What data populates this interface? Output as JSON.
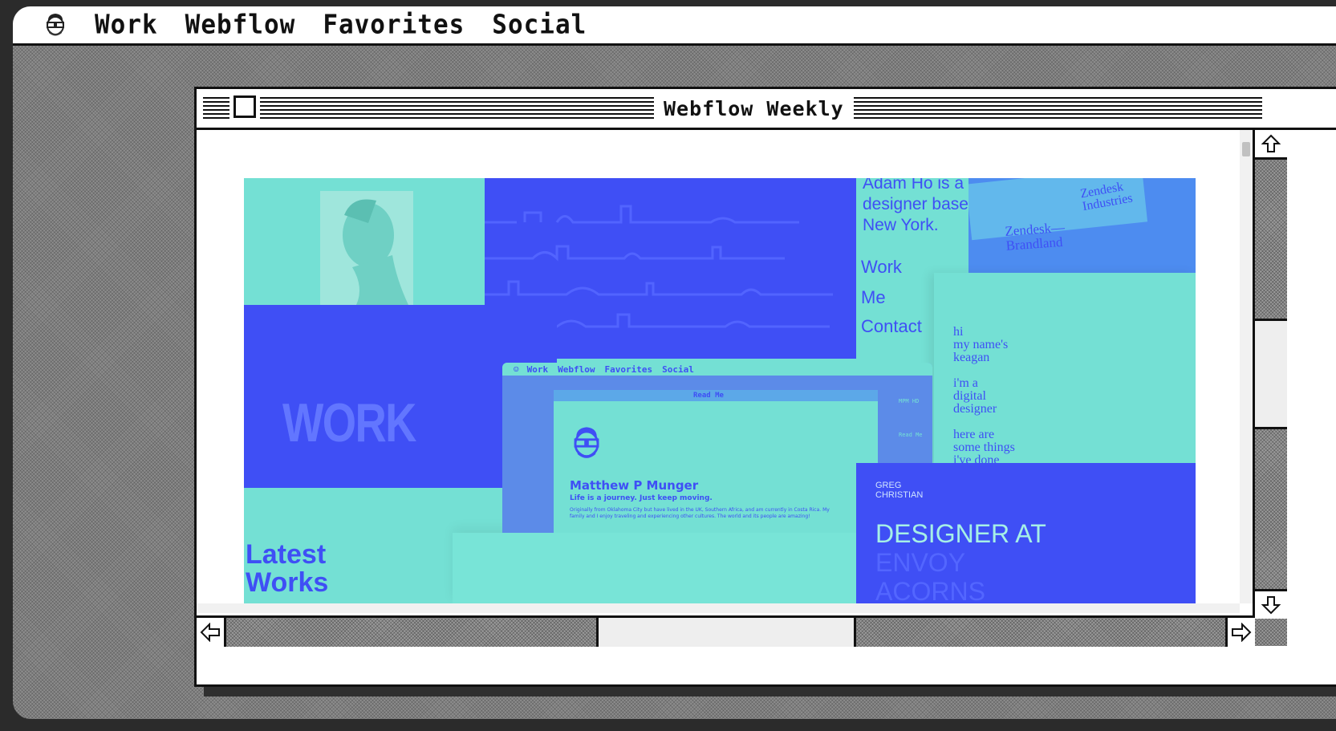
{
  "menubar": {
    "items": [
      "Work",
      "Webflow",
      "Favorites",
      "Social"
    ]
  },
  "window": {
    "title": "Webflow Weekly"
  },
  "preview": {
    "adam": {
      "intro": "Adam Ho is a designer based in New York.",
      "nav": [
        "Work",
        "Me",
        "Contact"
      ]
    },
    "zendesk": [
      "Zendesk Industries",
      "Zendesk— Brandland"
    ],
    "work_banner": "WORK",
    "keagan": [
      "hi",
      "my name's",
      "keagan",
      "i'm a",
      "digital",
      "designer",
      "here are",
      "some things",
      "i've done"
    ],
    "mini_site": {
      "menu": [
        "Work",
        "Webflow",
        "Favorites",
        "Social"
      ],
      "window_title": "Read Me",
      "name": "Matthew P Munger",
      "tagline": "Life is a journey. Just keep moving.",
      "bio": "Originally from Oklahoma City but have lived in the UK, Southern Africa, and am currently in Costa Rica. My family and I enjoy traveling and experiencing other cultures. The world and its people are amazing!",
      "desktop_icons": [
        "MPM HD",
        "Read Me"
      ]
    },
    "latest": [
      "Latest",
      "Works"
    ],
    "greg": {
      "name": [
        "GREG",
        "CHRISTIAN"
      ],
      "headline": "DESIGNER AT",
      "faded": [
        "ENVOY",
        "ACORNS"
      ]
    }
  },
  "colors": {
    "teal": "#74e0d4",
    "blue": "#3f4ff5",
    "desktop": "#8d8d8d"
  }
}
